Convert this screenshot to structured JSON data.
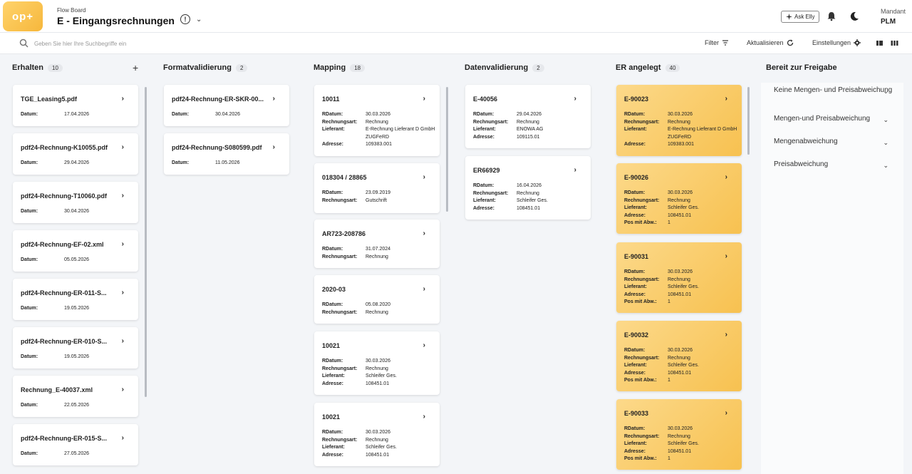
{
  "header": {
    "logo": "op+",
    "breadcrumb": "Flow Board",
    "title": "E - Eingangsrechnungen",
    "ask_label": "Ask Elly",
    "mandant_label": "Mandant",
    "mandant_value": "PLM"
  },
  "search": {
    "placeholder": "Geben Sie hier Ihre Suchbegriffe ein"
  },
  "toolbar": {
    "filter_label": "Filter",
    "refresh_label": "Aktualisieren",
    "settings_label": "Einstellungen"
  },
  "columns": [
    {
      "title": "Erhalten",
      "count": "10",
      "cards": [
        {
          "title": "TGE_Leasing5.pdf",
          "fields": [
            {
              "k": "Datum:",
              "v": "17.04.2026"
            }
          ]
        },
        {
          "title": "pdf24-Rechnung-K10055.pdf",
          "fields": [
            {
              "k": "Datum:",
              "v": "29.04.2026"
            }
          ]
        },
        {
          "title": "pdf24-Rechnung-T10060.pdf",
          "fields": [
            {
              "k": "Datum:",
              "v": "30.04.2026"
            }
          ]
        },
        {
          "title": "pdf24-Rechnung-EF-02.xml",
          "fields": [
            {
              "k": "Datum:",
              "v": "05.05.2026"
            }
          ]
        },
        {
          "title": "pdf24-Rechnung-ER-011-S...",
          "fields": [
            {
              "k": "Datum:",
              "v": "19.05.2026"
            }
          ]
        },
        {
          "title": "pdf24-Rechnung-ER-010-S...",
          "fields": [
            {
              "k": "Datum:",
              "v": "19.05.2026"
            }
          ]
        },
        {
          "title": "Rechnung_E-40037.xml",
          "fields": [
            {
              "k": "Datum:",
              "v": "22.05.2026"
            }
          ]
        },
        {
          "title": "pdf24-Rechnung-ER-015-S...",
          "fields": [
            {
              "k": "Datum:",
              "v": "27.05.2026"
            }
          ]
        }
      ]
    },
    {
      "title": "Formatvalidierung",
      "count": "2",
      "cards": [
        {
          "title": "pdf24-Rechnung-ER-SKR-00...",
          "fields": [
            {
              "k": "Datum:",
              "v": "30.04.2026"
            }
          ]
        },
        {
          "title": "pdf24-Rechnung-S080599.pdf",
          "fields": [
            {
              "k": "Datum:",
              "v": "11.05.2026"
            }
          ]
        }
      ]
    },
    {
      "title": "Mapping",
      "count": "18",
      "cards": [
        {
          "title": "10011",
          "fields": [
            {
              "k": "RDatum:",
              "v": "30.03.2026"
            },
            {
              "k": "Rechnungsart:",
              "v": "Rechnung"
            },
            {
              "k": "Lieferant:",
              "v": "E-Rechnung Lieferant D GmbH ZUGFeRD"
            },
            {
              "k": "Adresse:",
              "v": "109383.001"
            }
          ]
        },
        {
          "title": "018304 / 28865",
          "fields": [
            {
              "k": "RDatum:",
              "v": "23.09.2019"
            },
            {
              "k": "Rechnungsart:",
              "v": "Gutschrift"
            }
          ]
        },
        {
          "title": "AR723-208786",
          "fields": [
            {
              "k": "RDatum:",
              "v": "31.07.2024"
            },
            {
              "k": "Rechnungsart:",
              "v": "Rechnung"
            }
          ]
        },
        {
          "title": "2020-03",
          "fields": [
            {
              "k": "RDatum:",
              "v": "05.08.2020"
            },
            {
              "k": "Rechnungsart:",
              "v": "Rechnung"
            }
          ]
        },
        {
          "title": "10021",
          "fields": [
            {
              "k": "RDatum:",
              "v": "30.03.2026"
            },
            {
              "k": "Rechnungsart:",
              "v": "Rechnung"
            },
            {
              "k": "Lieferant:",
              "v": "Schleifer Ges."
            },
            {
              "k": "Adresse:",
              "v": "108451.01"
            }
          ]
        },
        {
          "title": "10021",
          "fields": [
            {
              "k": "RDatum:",
              "v": "30.03.2026"
            },
            {
              "k": "Rechnungsart:",
              "v": "Rechnung"
            },
            {
              "k": "Lieferant:",
              "v": "Schleifer Ges."
            },
            {
              "k": "Adresse:",
              "v": "108451.01"
            }
          ]
        }
      ]
    },
    {
      "title": "Datenvalidierung",
      "count": "2",
      "cards": [
        {
          "title": "E-40056",
          "fields": [
            {
              "k": "RDatum:",
              "v": "29.04.2026"
            },
            {
              "k": "Rechnungsart:",
              "v": "Rechnung"
            },
            {
              "k": "Lieferant:",
              "v": "ENOWA AG"
            },
            {
              "k": "Adresse:",
              "v": "109115.01"
            }
          ]
        },
        {
          "title": "ER66929",
          "fields": [
            {
              "k": "RDatum:",
              "v": "16.04.2026"
            },
            {
              "k": "Rechnungsart:",
              "v": "Rechnung"
            },
            {
              "k": "Lieferant:",
              "v": "Schleifer Ges."
            },
            {
              "k": "Adresse:",
              "v": "108451.01"
            }
          ]
        }
      ]
    },
    {
      "title": "ER angelegt",
      "count": "40",
      "cards": [
        {
          "title": "E-90023",
          "fields": [
            {
              "k": "RDatum:",
              "v": "30.03.2026"
            },
            {
              "k": "Rechnungsart:",
              "v": "Rechnung"
            },
            {
              "k": "Lieferant:",
              "v": "E-Rechnung Lieferant D GmbH ZUGFeRD"
            },
            {
              "k": "Adresse:",
              "v": "109383.001"
            }
          ]
        },
        {
          "title": "E-90026",
          "fields": [
            {
              "k": "RDatum:",
              "v": "30.03.2026"
            },
            {
              "k": "Rechnungsart:",
              "v": "Rechnung"
            },
            {
              "k": "Lieferant:",
              "v": "Schleifer Ges."
            },
            {
              "k": "Adresse:",
              "v": "108451.01"
            },
            {
              "k": "Pos mit Abw.:",
              "v": "1"
            }
          ]
        },
        {
          "title": "E-90031",
          "fields": [
            {
              "k": "RDatum:",
              "v": "30.03.2026"
            },
            {
              "k": "Rechnungsart:",
              "v": "Rechnung"
            },
            {
              "k": "Lieferant:",
              "v": "Schleifer Ges."
            },
            {
              "k": "Adresse:",
              "v": "108451.01"
            },
            {
              "k": "Pos mit Abw.:",
              "v": "1"
            }
          ]
        },
        {
          "title": "E-90032",
          "fields": [
            {
              "k": "RDatum:",
              "v": "30.03.2026"
            },
            {
              "k": "Rechnungsart:",
              "v": "Rechnung"
            },
            {
              "k": "Lieferant:",
              "v": "Schleifer Ges."
            },
            {
              "k": "Adresse:",
              "v": "108451.01"
            },
            {
              "k": "Pos mit Abw.:",
              "v": "1"
            }
          ]
        },
        {
          "title": "E-90033",
          "fields": [
            {
              "k": "RDatum:",
              "v": "30.03.2026"
            },
            {
              "k": "Rechnungsart:",
              "v": "Rechnung"
            },
            {
              "k": "Lieferant:",
              "v": "Schleifer Ges."
            },
            {
              "k": "Adresse:",
              "v": "108451.01"
            },
            {
              "k": "Pos mit Abw.:",
              "v": "1"
            }
          ]
        }
      ]
    },
    {
      "title": "Bereit zur Freigabe",
      "groups": [
        "Keine Mengen- und Preisabweichung",
        "Mengen-und Preisabweichung",
        "Mengenabweichung",
        "Preisabweichung"
      ]
    }
  ],
  "colors": {
    "accent": "#f7c150",
    "card_yellow": "#fcd98a",
    "background": "#f3f5f8"
  }
}
